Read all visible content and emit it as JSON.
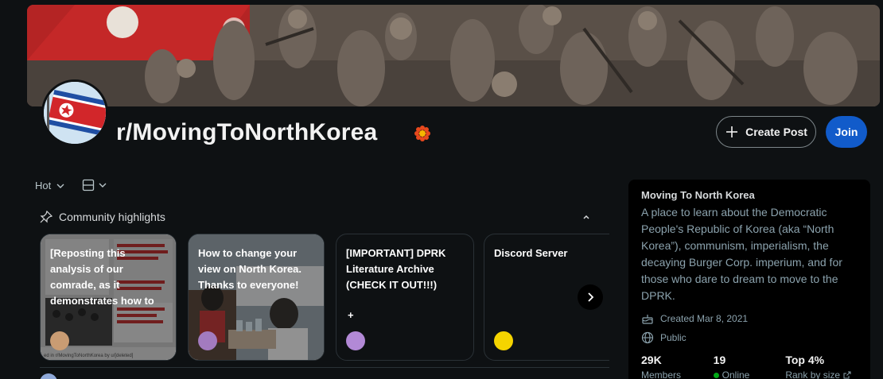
{
  "header": {
    "subreddit": "r/MovingToNorthKorea",
    "create_post_label": "Create Post",
    "join_label": "Join"
  },
  "feed": {
    "sort_label": "Hot",
    "highlights_label": "Community highlights"
  },
  "highlights": [
    {
      "text": "[Reposting this analysis of our comrade, as it demonstrates how to",
      "image_caption": "ed in r/MovingToNorthKorea by u/[deleted]"
    },
    {
      "text": "How to change your view on North Korea. Thanks to everyone!"
    },
    {
      "text": "[IMPORTANT] DPRK Literature Archive (CHECK IT OUT!!!)",
      "extra": "+"
    },
    {
      "text": "Discord Server"
    }
  ],
  "sidebar": {
    "name": "Moving To North Korea",
    "description": "A place to learn about the Democratic People's Republic of Korea (aka “North Korea”), communism, imperialism, the decaying Burger Corp. imperium, and for those who dare to dream to move to the DPRK.",
    "created": "Created Mar 8, 2021",
    "visibility": "Public",
    "stats": [
      {
        "value": "29K",
        "label": "Members"
      },
      {
        "value": "19",
        "label": "Online"
      },
      {
        "value": "Top 4%",
        "label": "Rank by size"
      }
    ]
  },
  "colors": {
    "join_button": "#115bca",
    "online_dot": "#01a816",
    "background": "#0e1113"
  },
  "icons": [
    "plus-icon",
    "chevron-down-icon",
    "layout-icon",
    "pin-icon",
    "chevron-up-icon",
    "chevron-right-icon",
    "cake-icon",
    "globe-icon",
    "external-link-icon"
  ]
}
